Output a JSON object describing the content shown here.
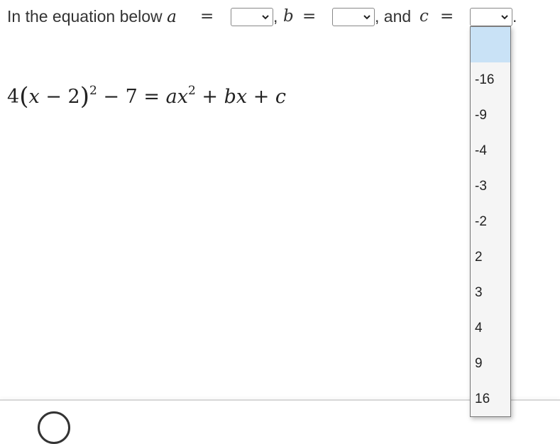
{
  "prompt": {
    "intro": "In the equation below",
    "var_a": "a",
    "var_b": "b",
    "var_c": "c",
    "equals": "=",
    "comma1": ",",
    "comma_and": ", and",
    "period": "."
  },
  "selects": {
    "a": {
      "selected": ""
    },
    "b": {
      "selected": ""
    },
    "c": {
      "selected": ""
    }
  },
  "equation": {
    "coef": "4",
    "lparen": "(",
    "x": "x",
    "minus1": "−",
    "two": "2",
    "rparen": ")",
    "exp": "2",
    "minus2": "−",
    "seven": "7",
    "eq": "=",
    "a": "a",
    "x2": "x",
    "exp2": "2",
    "plus1": "+",
    "b": "b",
    "x3": "x",
    "plus2": "+",
    "c": "c"
  },
  "dropdown": {
    "options": [
      "",
      "-16",
      "-9",
      "-4",
      "-3",
      "-2",
      "2",
      "3",
      "4",
      "9",
      "16"
    ],
    "highlight_color": "#c9e2f6"
  }
}
